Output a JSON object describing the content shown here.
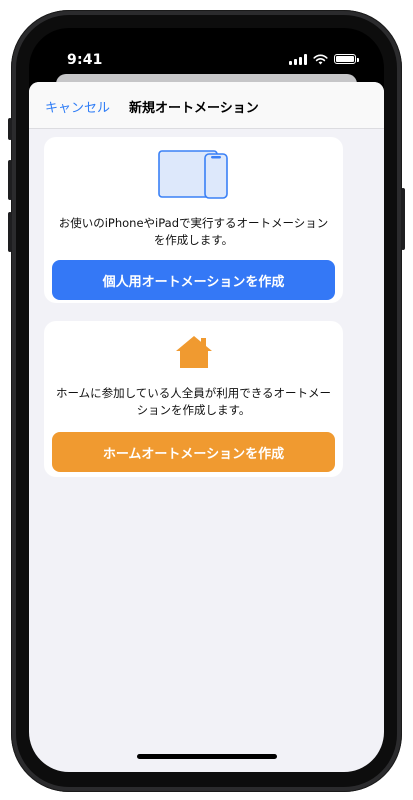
{
  "status_bar": {
    "time": "9:41"
  },
  "nav": {
    "cancel_label": "キャンセル",
    "title": "新規オートメーション"
  },
  "personal": {
    "icon": "ipad-iphone-icon",
    "description": "お使いのiPhoneやiPadで実行するオートメーションを作成します。",
    "button_label": "個人用オートメーションを作成",
    "accent": "#3478f6"
  },
  "home": {
    "icon": "house-icon",
    "description": "ホームに参加している人全員が利用できるオートメーションを作成します。",
    "button_label": "ホームオートメーションを作成",
    "accent": "#f09a30"
  }
}
